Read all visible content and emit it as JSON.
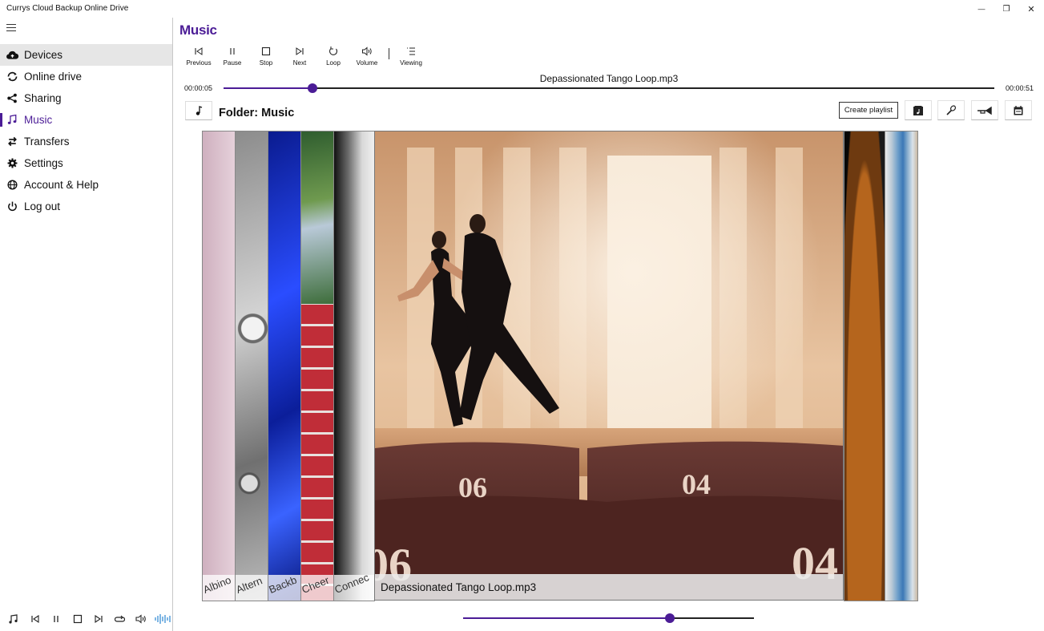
{
  "window": {
    "title": "Currys Cloud Backup Online Drive",
    "controls": {
      "minimize": "—",
      "restore": "❐",
      "close": "✕"
    }
  },
  "sidebar": {
    "items": [
      {
        "label": "Devices",
        "icon": "cloud-upload-icon"
      },
      {
        "label": "Online drive",
        "icon": "sync-icon"
      },
      {
        "label": "Sharing",
        "icon": "share-icon"
      },
      {
        "label": "Music",
        "icon": "music-note-icon"
      },
      {
        "label": "Transfers",
        "icon": "transfer-arrows-icon"
      },
      {
        "label": "Settings",
        "icon": "gear-icon"
      },
      {
        "label": "Account & Help",
        "icon": "globe-icon"
      },
      {
        "label": "Log out",
        "icon": "power-icon"
      }
    ],
    "mini_player_icons": [
      "music-list-icon",
      "previous-icon",
      "pause-icon",
      "stop-icon",
      "next-icon",
      "loop-icon",
      "volume-icon",
      "waveform-icon"
    ]
  },
  "page": {
    "title": "Music",
    "toolbar": {
      "previous": "Previous",
      "pause": "Pause",
      "stop": "Stop",
      "next": "Next",
      "loop": "Loop",
      "volume": "Volume",
      "viewing": "Viewing"
    },
    "player": {
      "elapsed": "00:00:05",
      "duration": "00:00:51",
      "track": "Depassionated Tango Loop.mp3",
      "progress_fraction": 0.115
    },
    "folder": {
      "title": "Folder: Music",
      "create_playlist": "Create playlist",
      "view_icons": [
        "album-icon",
        "microphone-icon",
        "trumpet-icon",
        "calendar-icon"
      ]
    },
    "coverflow": {
      "left_items": [
        "Albino",
        "Altern",
        "Backb",
        "Cheer",
        "Connec"
      ],
      "center": "Depassionated Tango Loop.mp3",
      "seats": [
        "06",
        "04",
        "06",
        "04"
      ]
    },
    "volume_fraction": 0.71
  },
  "colors": {
    "accent": "#4b1c96"
  }
}
